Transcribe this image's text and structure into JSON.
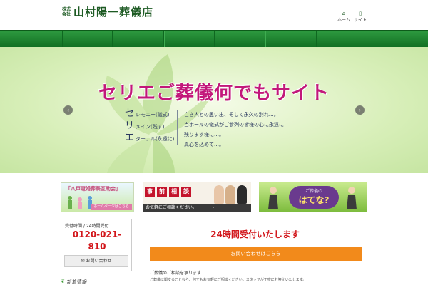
{
  "header": {
    "logo_small_top": "株式",
    "logo_small_bottom": "会社",
    "logo_main": "山村陽一葬儀店",
    "util": [
      {
        "icon": "⌂",
        "label": "ホーム"
      },
      {
        "icon": "▯",
        "label": "サイト"
      }
    ]
  },
  "hero": {
    "title": "セリエご葬儀何でもサイト",
    "sub": [
      {
        "head": "セ",
        "text": "レモニー(儀式)"
      },
      {
        "head": "リ",
        "text": "メイン(残す)"
      },
      {
        "head": "エ",
        "text": "ターナル(永遠に)"
      }
    ],
    "desc": [
      "亡き人との思い出、そして永久の別れ…。",
      "当ホールの儀式がご参列の皆様の心に永遠に",
      "残ります様に…。",
      "真心を込めて…。"
    ],
    "prev": "‹",
    "next": "›"
  },
  "banners": {
    "b1_title": "「八戸冠婚葬祭互助会」",
    "b1_foot": "ホームページはこちら",
    "b2_boxes": [
      "事",
      "前",
      "相",
      "談"
    ],
    "b2_bar": "お気軽にご相談ください。",
    "b2_chev": "›",
    "b3_small": "ご葬儀の",
    "b3_large": "はてな?"
  },
  "contact": {
    "heading": "受付時間 / 24時間受付",
    "phone": "0120-021-810",
    "button": "✉ お問い合わせ"
  },
  "sidebar_heading": "新着情報",
  "main": {
    "title": "24時間受付いたします",
    "cta": "お問い合わせはこちら",
    "p1": "ご葬儀のご相談を承ります",
    "p2": "ご葬儀に関することなら、何でもお気軽にご相談ください。スタッフが丁寧にお答えいたします。"
  }
}
